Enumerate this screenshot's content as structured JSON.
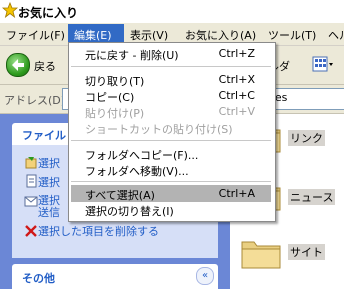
{
  "window": {
    "title": "お気に入り"
  },
  "menubar": {
    "items": [
      {
        "label": "ファイル(F)"
      },
      {
        "label": "編集(E)"
      },
      {
        "label": "表示(V)"
      },
      {
        "label": "お気に入り(A)"
      },
      {
        "label": "ツール(T)"
      },
      {
        "label": "ヘル"
      }
    ]
  },
  "toolbar": {
    "back_label": "戻る",
    "folders_partial": "ルダ"
  },
  "addressbar": {
    "label": "アドレス(D)",
    "value": "avorites"
  },
  "edit_menu": {
    "items": [
      {
        "label": "元に戻す - 削除(U)",
        "shortcut": "Ctrl+Z",
        "disabled": false
      },
      {
        "label": "切り取り(T)",
        "shortcut": "Ctrl+X",
        "disabled": false
      },
      {
        "label": "コピー(C)",
        "shortcut": "Ctrl+C",
        "disabled": false
      },
      {
        "label": "貼り付け(P)",
        "shortcut": "Ctrl+V",
        "disabled": true
      },
      {
        "label": "ショートカットの貼り付け(S)",
        "shortcut": "",
        "disabled": true
      },
      {
        "label": "フォルダへコピー(F)...",
        "shortcut": "",
        "disabled": false
      },
      {
        "label": "フォルダへ移動(V)...",
        "shortcut": "",
        "disabled": false
      },
      {
        "label": "すべて選択(A)",
        "shortcut": "Ctrl+A",
        "disabled": false,
        "highlighted": true
      },
      {
        "label": "選択の切り替え(I)",
        "shortcut": "",
        "disabled": false
      }
    ]
  },
  "task_pane": {
    "file_ops_title": "ファイル",
    "tasks": [
      {
        "label": "選択"
      },
      {
        "label": "選択"
      },
      {
        "label": "選択"
      },
      {
        "label": "送信"
      },
      {
        "label": "選択した項目を削除する"
      }
    ],
    "other_title": "その他",
    "collapse_glyph": "«"
  },
  "folders": [
    {
      "label": "リンク"
    },
    {
      "label": "ニュース"
    },
    {
      "label": "サイト"
    }
  ],
  "colors": {
    "menu_highlight": "#316ac5",
    "task_link": "#215dc6",
    "task_pane_bg": "#6b87d6",
    "selected_item_bg": "#b3b3b3"
  },
  "icons": {
    "title": "star-icon",
    "back": "back-arrow-icon",
    "views": "views-icon",
    "folder": "folder-icon",
    "delete": "delete-x-icon",
    "collapse": "chevron-double-up-icon"
  }
}
